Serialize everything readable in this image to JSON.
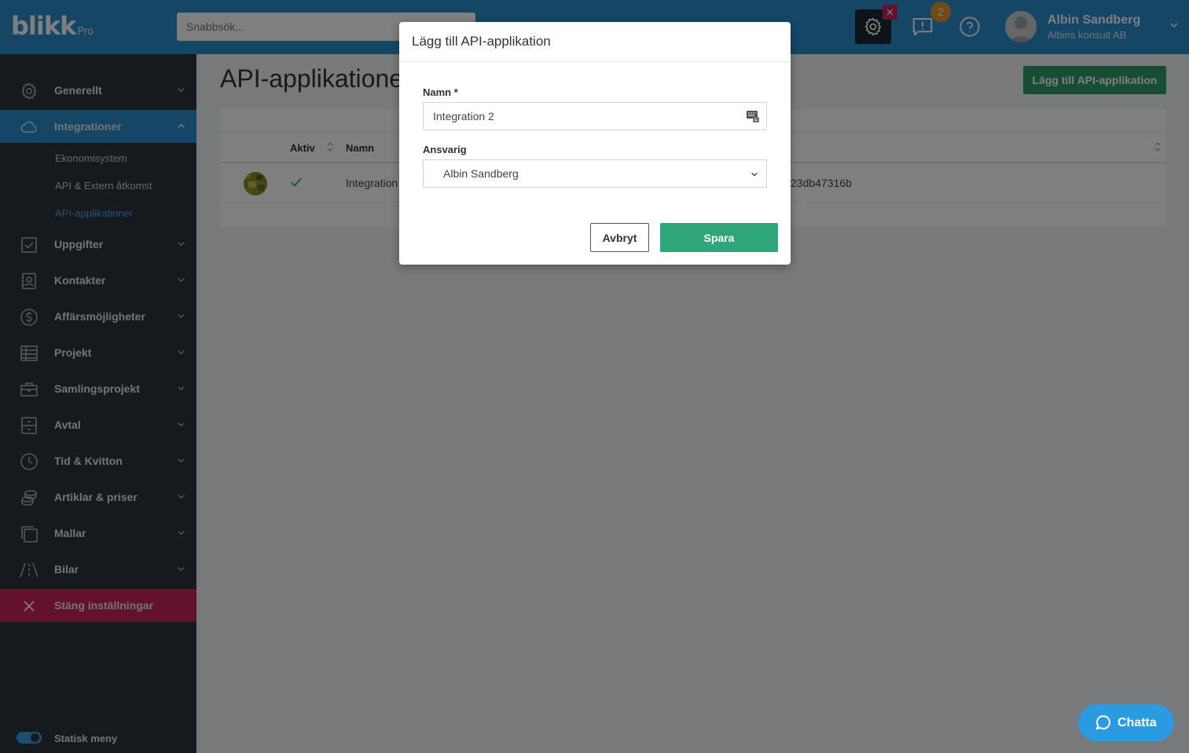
{
  "app": {
    "logo": "blikk",
    "logo_suffix": "Pro"
  },
  "topbar": {
    "search_placeholder": "Snabbsök...",
    "settings_close": "×",
    "notification_count": "2",
    "user_name": "Albin Sandberg",
    "user_company": "Albins konsult AB"
  },
  "sidebar": {
    "items": [
      {
        "label": "Generellt",
        "icon": "gear-icon"
      },
      {
        "label": "Integrationer",
        "icon": "cloud-icon"
      },
      {
        "label": "Uppgifter",
        "icon": "checkbox-icon"
      },
      {
        "label": "Kontakter",
        "icon": "contact-icon"
      },
      {
        "label": "Affärsmöjligheter",
        "icon": "dollar-icon"
      },
      {
        "label": "Projekt",
        "icon": "table-icon"
      },
      {
        "label": "Samlingsprojekt",
        "icon": "briefcase-icon"
      },
      {
        "label": "Avtal",
        "icon": "cabinet-icon"
      },
      {
        "label": "Tid & Kvitton",
        "icon": "clock-icon"
      },
      {
        "label": "Artiklar & priser",
        "icon": "coins-icon"
      },
      {
        "label": "Mallar",
        "icon": "copy-icon"
      },
      {
        "label": "Bilar",
        "icon": "road-icon"
      }
    ],
    "sub_items": [
      "Ekonomisystem",
      "API & Extern åtkomst",
      "API-applikationer"
    ],
    "close_settings": "Stäng inställningar",
    "static_menu": "Statisk meny"
  },
  "main": {
    "title": "API-applikationer",
    "add_button": "Lägg till API-applikation",
    "columns": [
      "Aktiv",
      "Namn"
    ],
    "rows": [
      {
        "active": true,
        "name": "Integration",
        "key": "23db47316b"
      }
    ]
  },
  "modal": {
    "title": "Lägg till API-applikation",
    "name_label": "Namn *",
    "name_value": "Integration 2",
    "responsible_label": "Ansvarig",
    "responsible_value": "Albin Sandberg",
    "cancel": "Avbryt",
    "save": "Spara"
  },
  "chat": {
    "label": "Chatta"
  },
  "colors": {
    "brand": "#2a8ccd",
    "sidebar": "#2c343d",
    "save": "#2fa57a",
    "close": "#c8235a",
    "badge": "#e2952e"
  }
}
